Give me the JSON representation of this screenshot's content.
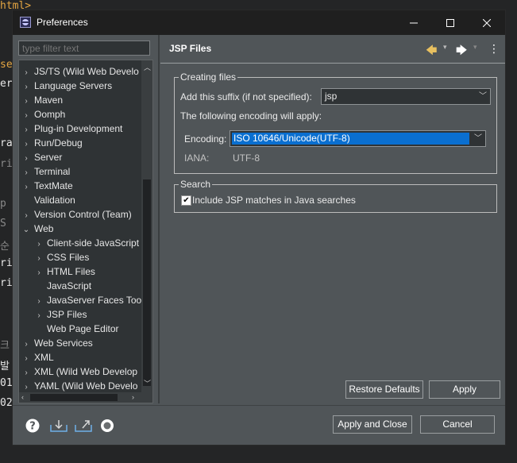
{
  "background_code": {
    "lines": [
      "html>",
      "se",
      "er",
      "ra",
      "ri",
      "p",
      "S",
      "순",
      "ri",
      "ri",
      "크",
      "발",
      "01",
      "02"
    ]
  },
  "dialog": {
    "title": "Preferences",
    "window_controls": {
      "minimize": "—",
      "maximize": "☐",
      "close": "✕"
    }
  },
  "filter": {
    "placeholder": "type filter text"
  },
  "tree": {
    "items": [
      {
        "label": "JS/TS (Wild Web Develo",
        "expander": "›",
        "level": 0
      },
      {
        "label": "Language Servers",
        "expander": "›",
        "level": 0
      },
      {
        "label": "Maven",
        "expander": "›",
        "level": 0
      },
      {
        "label": "Oomph",
        "expander": "›",
        "level": 0
      },
      {
        "label": "Plug-in Development",
        "expander": "›",
        "level": 0
      },
      {
        "label": "Run/Debug",
        "expander": "›",
        "level": 0
      },
      {
        "label": "Server",
        "expander": "›",
        "level": 0
      },
      {
        "label": "Terminal",
        "expander": "›",
        "level": 0
      },
      {
        "label": "TextMate",
        "expander": "›",
        "level": 0
      },
      {
        "label": "Validation",
        "expander": "",
        "level": 0
      },
      {
        "label": "Version Control (Team)",
        "expander": "›",
        "level": 0
      },
      {
        "label": "Web",
        "expander": "⌄",
        "level": 0
      },
      {
        "label": "Client-side JavaScript",
        "expander": "›",
        "level": 1
      },
      {
        "label": "CSS Files",
        "expander": "›",
        "level": 1
      },
      {
        "label": "HTML Files",
        "expander": "›",
        "level": 1
      },
      {
        "label": "JavaScript",
        "expander": "",
        "level": 1
      },
      {
        "label": "JavaServer Faces Tool",
        "expander": "›",
        "level": 1
      },
      {
        "label": "JSP Files",
        "expander": "›",
        "level": 1
      },
      {
        "label": "Web Page Editor",
        "expander": "",
        "level": 1
      },
      {
        "label": "Web Services",
        "expander": "›",
        "level": 0
      },
      {
        "label": "XML",
        "expander": "›",
        "level": 0
      },
      {
        "label": "XML (Wild Web Develop",
        "expander": "›",
        "level": 0
      },
      {
        "label": "YAML (Wild Web Develo",
        "expander": "›",
        "level": 0
      }
    ]
  },
  "page": {
    "title": "JSP Files",
    "creating": {
      "legend": "Creating files",
      "suffix_label": "Add this suffix (if not specified):",
      "suffix_value": "jsp",
      "encoding_note": "The following encoding will apply:",
      "encoding_label": "Encoding:",
      "encoding_value": "ISO 10646/Unicode(UTF-8)",
      "iana_label": "IANA:",
      "iana_value": "UTF-8"
    },
    "search": {
      "legend": "Search",
      "include_label": "Include JSP matches in Java searches",
      "include_checked": true
    },
    "restore_defaults": "Restore Defaults",
    "apply": "Apply"
  },
  "footer": {
    "apply_and_close": "Apply and Close",
    "cancel": "Cancel"
  },
  "colors": {
    "accent": "#0a6fd0",
    "nav_arrow": "#e8c060"
  }
}
